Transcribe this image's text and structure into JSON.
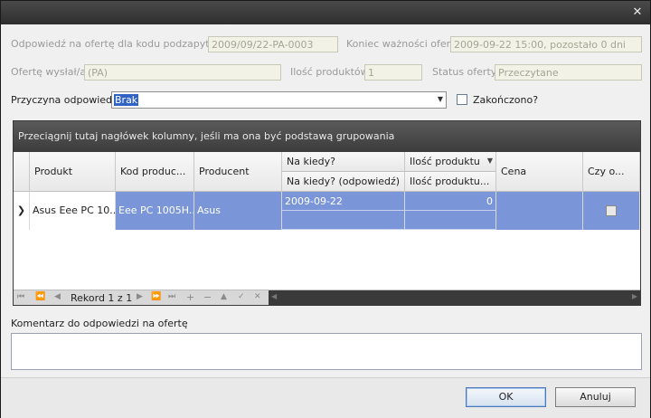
{
  "form": {
    "response_code_label": "Odpowiedź na ofertę dla kodu podzapytania",
    "response_code_value": "2009/09/22-PA-0003",
    "expiry_label": "Koniec ważności oferty",
    "expiry_value": "2009-09-22 15:00, pozostało 0 dni",
    "sent_by_label": "Ofertę wysłał/a",
    "sent_by_value": "(PA)",
    "product_count_label": "Ilość produktów",
    "product_count_value": "1",
    "status_label": "Status oferty",
    "status_value": "Przeczytane",
    "reason_label": "Przyczyna odpowiedzi",
    "reason_value": "Brak",
    "finished_label": "Zakończono?"
  },
  "grid": {
    "group_panel_text": "Przeciągnij tutaj nagłówek kolumny, jeśli ma ona być podstawą grupowania",
    "columns": {
      "product": "Produkt",
      "product_code": "Kod produc...",
      "producer": "Producent",
      "when": "Na kiedy?",
      "when_response": "Na kiedy? (odpowiedź)",
      "quantity": "Ilość produktu",
      "quantity_response": "Ilość produktu...",
      "price": "Cena",
      "is_it": "Czy o..."
    },
    "rows": [
      {
        "product": "Asus Eee PC 10...",
        "product_code": "Eee PC 1005H...",
        "producer": "Asus",
        "when": "2009-09-22",
        "when_response": "",
        "quantity": "0",
        "quantity_response": "",
        "price": "",
        "checked": false
      }
    ],
    "navigator_text": "Rekord 1 z 1"
  },
  "comment_label": "Komentarz do odpowiedzi na ofertę",
  "buttons": {
    "ok": "OK",
    "cancel": "Anuluj"
  }
}
